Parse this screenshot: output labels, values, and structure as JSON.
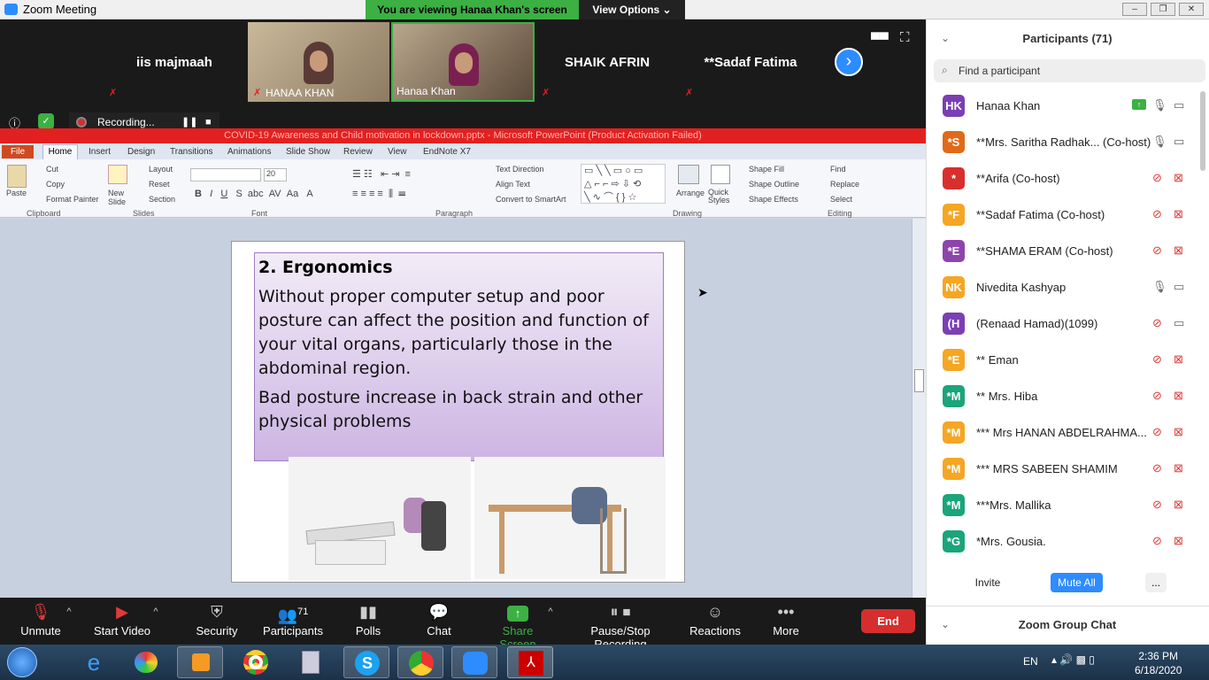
{
  "window": {
    "title": "Zoom Meeting",
    "viewing_banner": "You are viewing Hanaa Khan's screen",
    "view_options": "View Options"
  },
  "video_strip": {
    "tiles": [
      {
        "name": "iis majmaah",
        "label": ""
      },
      {
        "name": "",
        "label": "HANAA KHAN"
      },
      {
        "name": "",
        "label": "Hanaa Khan"
      },
      {
        "name": "SHAIK AFRIN",
        "label": ""
      },
      {
        "name": "**Sadaf Fatima",
        "label": ""
      }
    ]
  },
  "recording": {
    "label": "Recording..."
  },
  "powerpoint": {
    "title": "COVID-19 Awareness and Child motivation in lockdown.pptx - Microsoft PowerPoint (Product Activation Failed)",
    "tabs": [
      "File",
      "Home",
      "Insert",
      "Design",
      "Transitions",
      "Animations",
      "Slide Show",
      "Review",
      "View",
      "EndNote X7"
    ],
    "ribbon": {
      "clipboard": {
        "paste": "Paste",
        "cut": "Cut",
        "copy": "Copy",
        "format_painter": "Format Painter",
        "group": "Clipboard"
      },
      "slides": {
        "new_slide": "New Slide",
        "layout": "Layout",
        "reset": "Reset",
        "section": "Section",
        "group": "Slides"
      },
      "font": {
        "size": "20",
        "group": "Font"
      },
      "paragraph": {
        "text_direction": "Text Direction",
        "align_text": "Align Text",
        "smartart": "Convert to SmartArt",
        "group": "Paragraph"
      },
      "drawing": {
        "arrange": "Arrange",
        "quick_styles": "Quick Styles",
        "shape_fill": "Shape Fill",
        "shape_outline": "Shape Outline",
        "shape_effects": "Shape Effects",
        "group": "Drawing"
      },
      "editing": {
        "find": "Find",
        "replace": "Replace",
        "select": "Select",
        "group": "Editing"
      }
    },
    "slide": {
      "heading": "2. Ergonomics",
      "para1": "Without proper computer setup  and poor posture can affect the position and function of your vital organs, particularly those in the abdominal region.",
      "para2": "Bad posture increase in back strain and other physical problems"
    }
  },
  "toolbar": {
    "unmute": "Unmute",
    "start_video": "Start Video",
    "security": "Security",
    "participants": "Participants",
    "participants_count": "71",
    "polls": "Polls",
    "chat": "Chat",
    "share_screen": "Share Screen",
    "pause_stop": "Pause/Stop Recording",
    "reactions": "Reactions",
    "more": "More",
    "end": "End"
  },
  "panel": {
    "title": "Participants (71)",
    "search_placeholder": "Find a participant",
    "participants": [
      {
        "initials": "HK",
        "name": "Hanaa Khan",
        "color": "#7b3fb3"
      },
      {
        "initials": "*S",
        "name": "**Mrs. Saritha Radhak... (Co-host)",
        "color": "#e06a1a"
      },
      {
        "initials": "*",
        "name": "**Arifa (Co-host)",
        "color": "#d92e2e"
      },
      {
        "initials": "*F",
        "name": "**Sadaf Fatima (Co-host)",
        "color": "#f5a623"
      },
      {
        "initials": "*E",
        "name": "**SHAMA ERAM (Co-host)",
        "color": "#8e44ad"
      },
      {
        "initials": "NK",
        "name": "Nivedita Kashyap",
        "color": "#f5a623"
      },
      {
        "initials": "(H",
        "name": "(Renaad Hamad)(1099)",
        "color": "#7b3fb3"
      },
      {
        "initials": "*E",
        "name": "** Eman",
        "color": "#f5a623"
      },
      {
        "initials": "*M",
        "name": "** Mrs. Hiba",
        "color": "#1aa57a"
      },
      {
        "initials": "*M",
        "name": "*** Mrs HANAN ABDELRAHMA...",
        "color": "#f5a623"
      },
      {
        "initials": "*M",
        "name": "*** MRS SABEEN SHAMIM",
        "color": "#f5a623"
      },
      {
        "initials": "*M",
        "name": "***Mrs. Mallika",
        "color": "#1aa57a"
      },
      {
        "initials": "*G",
        "name": "*Mrs. Gousia.",
        "color": "#1aa57a"
      }
    ],
    "invite": "Invite",
    "mute_all": "Mute All",
    "more": "...",
    "chat_title": "Zoom Group Chat"
  },
  "taskbar": {
    "lang": "EN",
    "time": "2:36 PM",
    "date": "6/18/2020"
  }
}
